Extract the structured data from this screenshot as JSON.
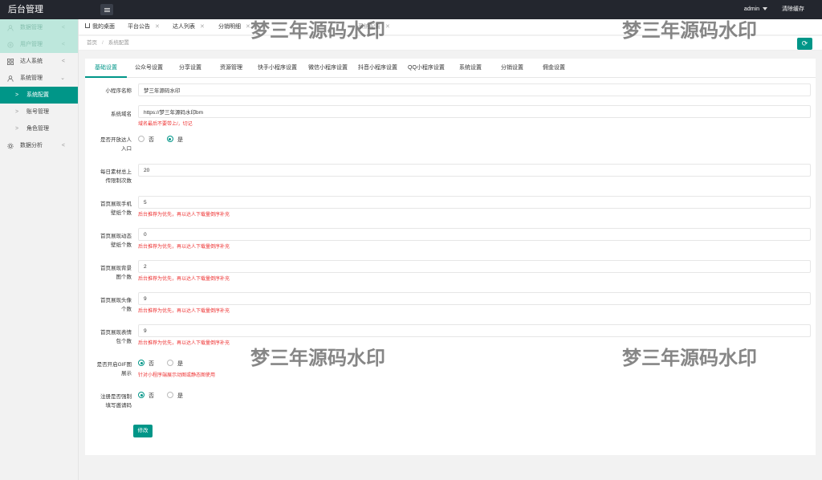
{
  "header": {
    "title": "后台管理",
    "user": "admin",
    "clear_cache": "清除缓存"
  },
  "sidebar": {
    "items": [
      {
        "label": "数据管理",
        "icon": "user-icon"
      },
      {
        "label": "用户管理",
        "icon": "user-add-icon"
      },
      {
        "label": "达人系统",
        "icon": "grid-icon"
      },
      {
        "label": "系统管理",
        "icon": "person-icon"
      },
      {
        "label": "系统配置"
      },
      {
        "label": "账号管理"
      },
      {
        "label": "角色管理"
      },
      {
        "label": "数据分析",
        "icon": "gear-icon"
      }
    ]
  },
  "page_tabs": [
    {
      "label": "我的桌面"
    },
    {
      "label": "平台公告"
    },
    {
      "label": "达人列表"
    },
    {
      "label": "分销明细"
    },
    {
      "label": "系统配置"
    }
  ],
  "breadcrumb": {
    "home": "首页",
    "sep": "/",
    "current": "系统配置"
  },
  "settings_tabs": [
    "基础设置",
    "公众号设置",
    "分享设置",
    "资源管理",
    "快手小程序设置",
    "微信小程序设置",
    "抖音小程序设置",
    "QQ小程序设置",
    "系统设置",
    "分销设置",
    "佣金设置"
  ],
  "form": {
    "mini_name": {
      "label": "小程序名称",
      "value": "梦三年源码水印"
    },
    "domain": {
      "label": "系统域名",
      "value": "https://梦三年源码水印bm",
      "hint": "域名最后不要带上/，切记"
    },
    "talent_entry": {
      "label1": "是否开放达人",
      "label2": "入口",
      "no": "否",
      "yes": "是",
      "selected": "yes"
    },
    "daily_upload": {
      "label1": "每日素材总上",
      "label2": "传限制次数",
      "value": "20"
    },
    "phone_wallpaper": {
      "label1": "首页展现手机",
      "label2": "壁纸个数",
      "value": "5",
      "hint": "后台推荐为优先，再以达人下载量倒序补充"
    },
    "dynamic_wallpaper": {
      "label1": "首页展现动态",
      "label2": "壁纸个数",
      "value": "0",
      "hint": "后台推荐为优先，再以达人下载量倒序补充"
    },
    "background": {
      "label1": "首页展现背景",
      "label2": "图个数",
      "value": "2",
      "hint": "后台推荐为优先，再以达人下载量倒序补充"
    },
    "avatar": {
      "label1": "首页展现头像",
      "label2": "个数",
      "value": "9",
      "hint": "后台推荐为优先，再以达人下载量倒序补充"
    },
    "emoji": {
      "label1": "首页展现表情",
      "label2": "包个数",
      "value": "9",
      "hint": "后台推荐为优先，再以达人下载量倒序补充"
    },
    "gif": {
      "label1": "是否开启GIF图",
      "label2": "展示",
      "no": "否",
      "yes": "是",
      "selected": "no",
      "hint": "针对小程序端展示动图或静态图使用"
    },
    "invite": {
      "label1": "注册是否强制",
      "label2": "填写邀请码",
      "no": "否",
      "yes": "是",
      "selected": "no"
    },
    "submit": "修改"
  },
  "watermark": "梦三年源码水印",
  "colors": {
    "accent": "#009688",
    "topbar": "#23262e",
    "hint": "#ee3333"
  }
}
